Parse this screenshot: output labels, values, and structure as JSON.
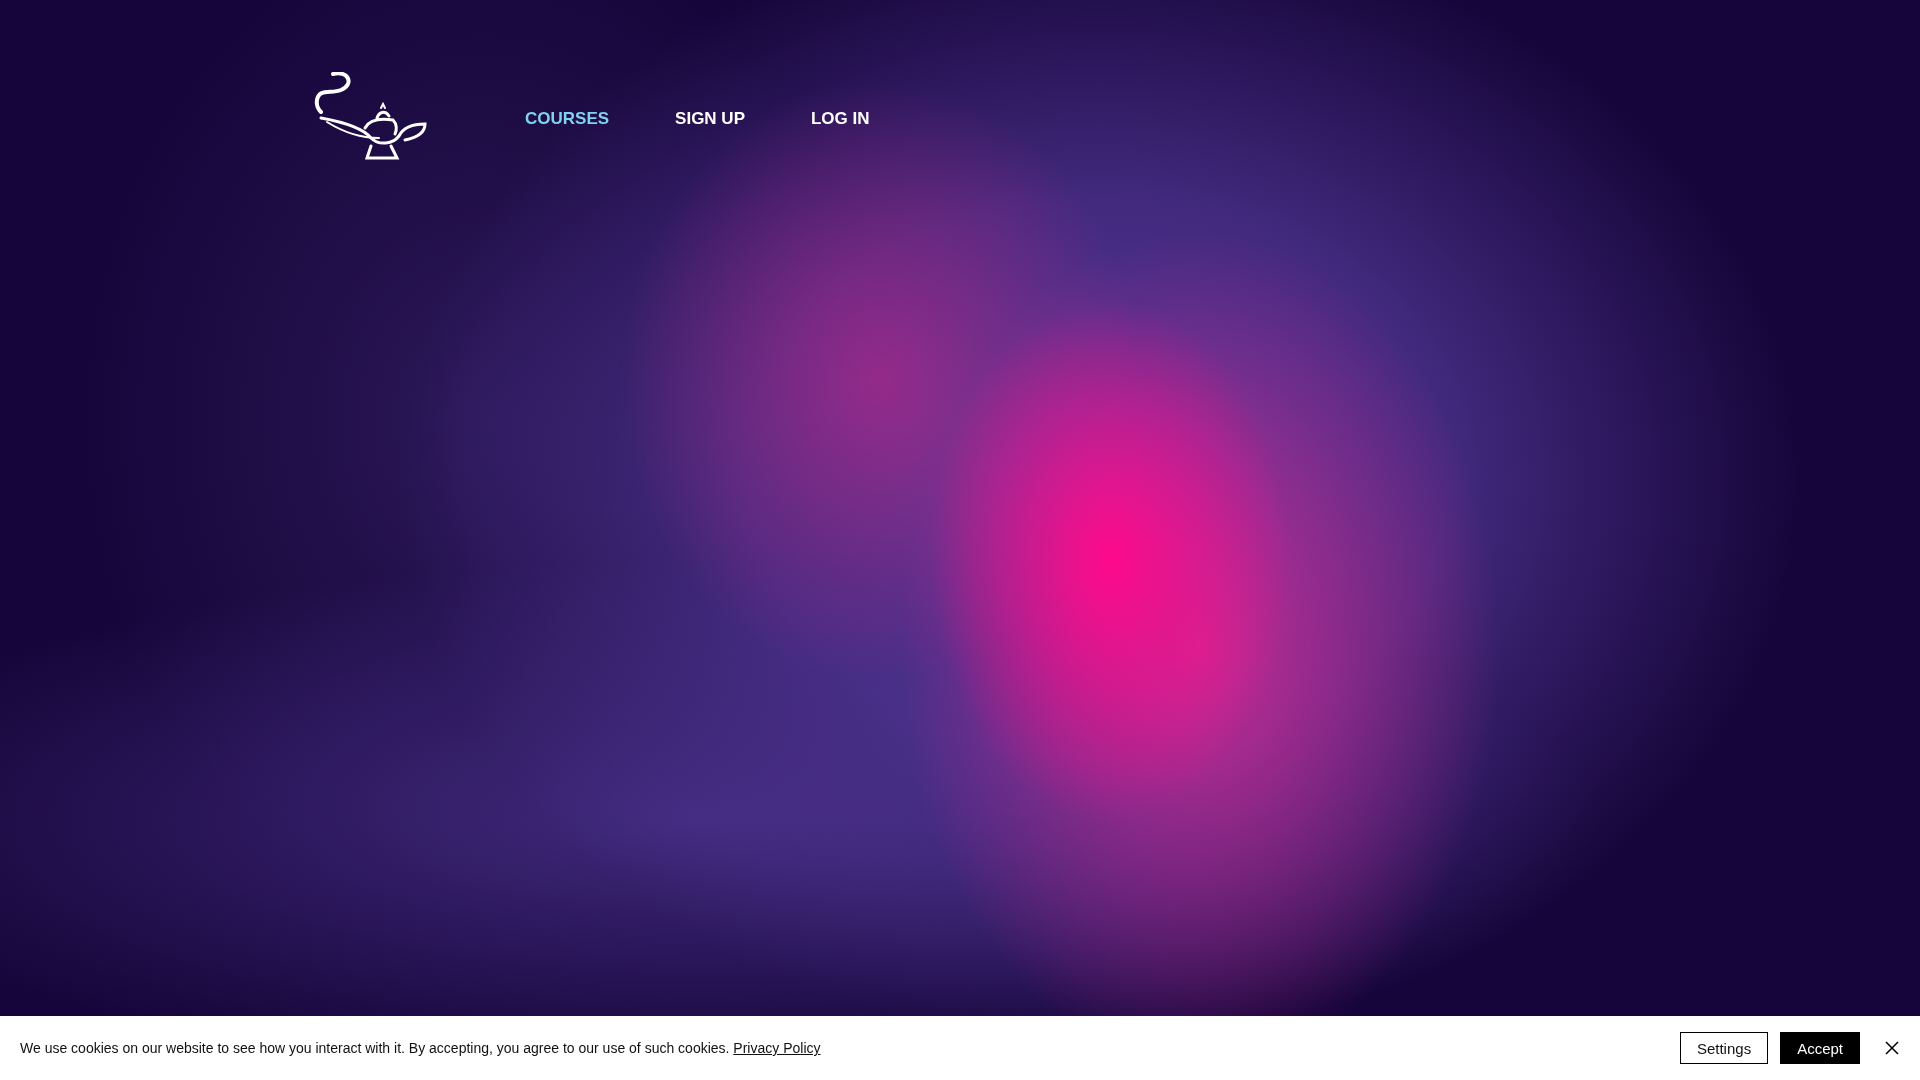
{
  "nav": [
    {
      "label": "COURSES",
      "selected": true
    },
    {
      "label": "SIGN UP",
      "selected": false
    },
    {
      "label": "LOG IN",
      "selected": false
    }
  ],
  "cookie_banner": {
    "message": "We use cookies on our website to see how you interact with it. By accepting, you agree to our use of such cookies.",
    "link": "Privacy Policy",
    "buttons": [
      {
        "label": "Settings",
        "kind": "outline"
      },
      {
        "label": "Accept",
        "kind": "filled"
      }
    ]
  }
}
